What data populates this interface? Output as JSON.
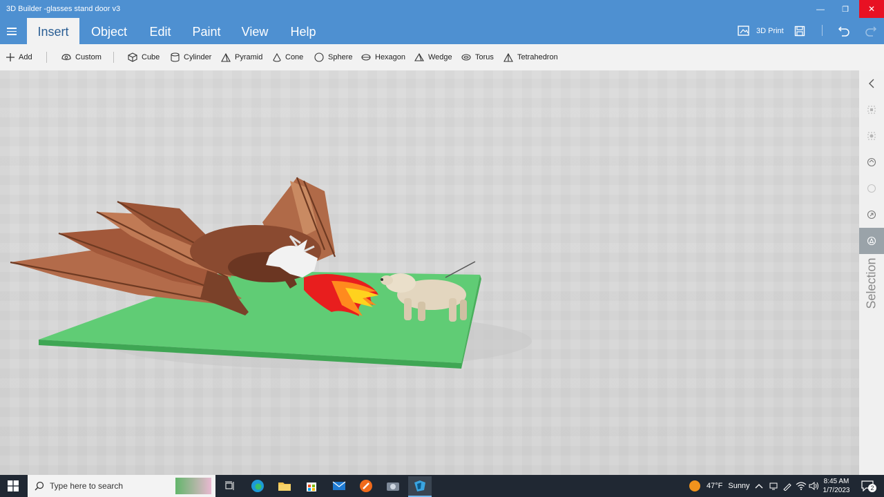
{
  "window": {
    "title": "3D Builder -glasses stand door v3",
    "minimize": "—",
    "restore": "❐",
    "close": "✕"
  },
  "ribbon": {
    "tabs": [
      "Insert",
      "Object",
      "Edit",
      "Paint",
      "View",
      "Help"
    ],
    "active_tab": "Insert",
    "print_label": "3D Print"
  },
  "toolbar": {
    "add": "Add",
    "custom": "Custom",
    "shapes": [
      "Cube",
      "Cylinder",
      "Pyramid",
      "Cone",
      "Sphere",
      "Hexagon",
      "Wedge",
      "Torus",
      "Tetrahedron"
    ]
  },
  "right_panel": {
    "label": "Selection"
  },
  "taskbar": {
    "search_placeholder": "Type here to search",
    "weather_temp": "47°F",
    "weather_desc": "Sunny",
    "time": "8:45 AM",
    "date": "1/7/2023",
    "notification_count": "2"
  },
  "colors": {
    "accent": "#4e90d1",
    "plate": "#5ecb74",
    "taskbar": "#202833"
  }
}
